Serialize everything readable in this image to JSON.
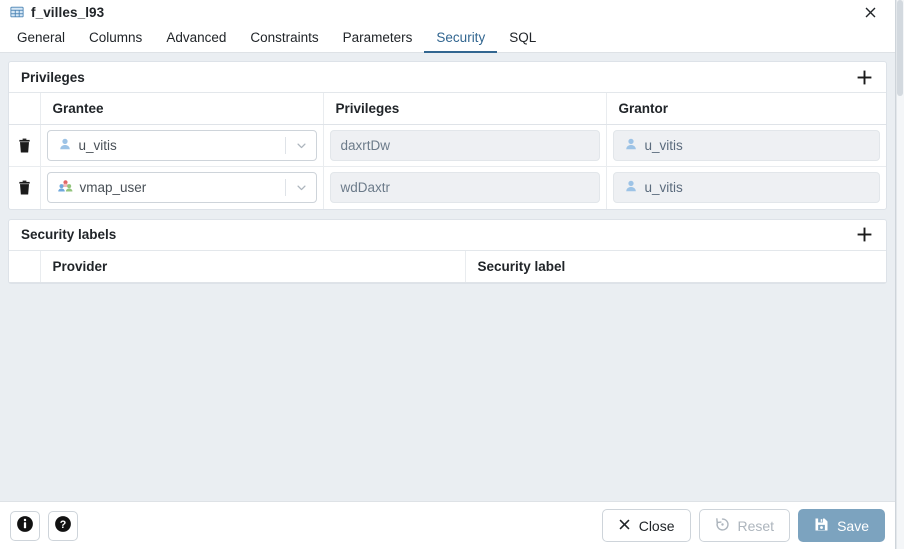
{
  "window": {
    "title": "f_villes_l93",
    "title_icon": "table-icon",
    "close_icon": "close-icon"
  },
  "tabs": [
    {
      "label": "General",
      "active": false
    },
    {
      "label": "Columns",
      "active": false
    },
    {
      "label": "Advanced",
      "active": false
    },
    {
      "label": "Constraints",
      "active": false
    },
    {
      "label": "Parameters",
      "active": false
    },
    {
      "label": "Security",
      "active": true
    },
    {
      "label": "SQL",
      "active": false
    }
  ],
  "privileges_panel": {
    "title": "Privileges",
    "add_icon": "plus-icon",
    "columns": [
      "Grantee",
      "Privileges",
      "Grantor"
    ],
    "rows": [
      {
        "delete_icon": "trash-icon",
        "grantee": {
          "value": "u_vitis",
          "icon": "user-icon"
        },
        "privileges": {
          "value": "daxrtDw"
        },
        "grantor": {
          "value": "u_vitis",
          "icon": "user-icon"
        }
      },
      {
        "delete_icon": "trash-icon",
        "grantee": {
          "value": "vmap_user",
          "icon": "group-icon"
        },
        "privileges": {
          "value": "wdDaxtr"
        },
        "grantor": {
          "value": "u_vitis",
          "icon": "user-icon"
        }
      }
    ]
  },
  "security_labels_panel": {
    "title": "Security labels",
    "add_icon": "plus-icon",
    "columns": [
      "Provider",
      "Security label"
    ],
    "rows": []
  },
  "footer": {
    "info_icon": "info-icon",
    "help_icon": "help-icon",
    "close_label": "Close",
    "close_icon": "cross-icon",
    "reset_label": "Reset",
    "reset_icon": "reset-icon",
    "save_label": "Save",
    "save_icon": "save-icon"
  },
  "colors": {
    "accent": "#326690",
    "save_button": "#7ca3bf",
    "body_background": "#eaeef2",
    "panel_background": "#ffffff",
    "disabled_text": "#adb5bd"
  }
}
